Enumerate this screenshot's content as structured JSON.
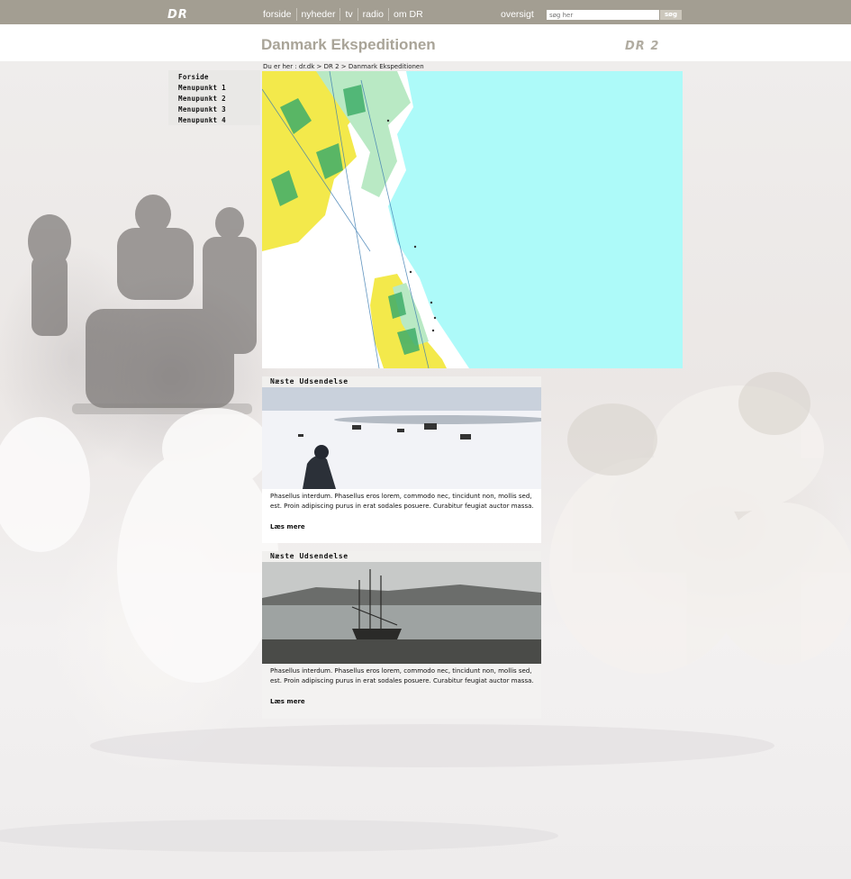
{
  "topbar": {
    "logo": "DR",
    "nav": [
      "forside",
      "nyheder",
      "tv",
      "radio",
      "om DR"
    ],
    "overview_link": "oversigt",
    "search_placeholder": "søg her",
    "search_button": "søg"
  },
  "header": {
    "title": "Danmark Ekspeditionen",
    "channel_logo": "DR 2"
  },
  "breadcrumb": "Du er her : dr.dk > DR 2 > Danmark Ekspeditionen",
  "menu": [
    "Forside",
    "Menupunkt 1",
    "Menupunkt 2",
    "Menupunkt 3",
    "Menupunkt 4"
  ],
  "cards": [
    {
      "heading": "Næste Udsendelse",
      "image": "expedition-camp-on-ice",
      "text": "Phasellus interdum. Phasellus eros lorem, commodo nec, tincidunt non, mollis sed, est. Proin adipiscing purus in erat sodales posuere. Curabitur feugiat auctor massa.",
      "link": "Læs mere"
    },
    {
      "heading": "Næste Udsendelse",
      "image": "historic-ship-in-harbour",
      "text": "Phasellus interdum. Phasellus eros lorem, commodo nec, tincidunt non, mollis sed, est. Proin adipiscing purus in erat sodales posuere. Curabitur feugiat auctor massa.",
      "link": "Læs mere"
    }
  ],
  "colors": {
    "topbar": "#a39e92",
    "title": "#a9a498",
    "sea": "#adfaf9",
    "land": "#f2e84a"
  }
}
